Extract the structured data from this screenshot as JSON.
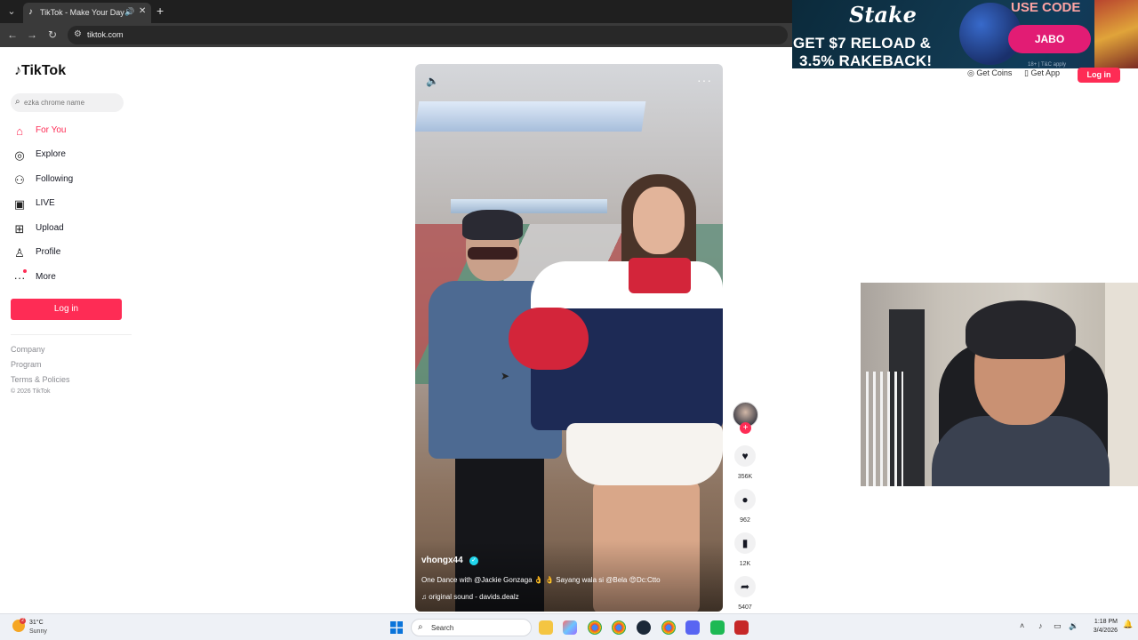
{
  "browser": {
    "tab_title": "TikTok - Make Your Day",
    "tab_close": "✕",
    "new_tab": "+",
    "url": "tiktok.com"
  },
  "ad": {
    "brand": "Stake",
    "line1": "GET $7 RELOAD &",
    "line2": "3.5% RAKEBACK!",
    "code_label": "USE CODE",
    "code": "JABO",
    "fine_print": "18+ | T&C apply"
  },
  "header": {
    "get_coins": "Get Coins",
    "get_app": "Get App",
    "login": "Log in"
  },
  "sidebar": {
    "logo": "TikTok",
    "search_placeholder": "ezka chrome name",
    "items": [
      {
        "label": "For You",
        "icon": "home-icon"
      },
      {
        "label": "Explore",
        "icon": "compass-icon"
      },
      {
        "label": "Following",
        "icon": "following-icon"
      },
      {
        "label": "LIVE",
        "icon": "live-icon"
      },
      {
        "label": "Upload",
        "icon": "upload-icon"
      },
      {
        "label": "Profile",
        "icon": "profile-icon"
      },
      {
        "label": "More",
        "icon": "more-icon"
      }
    ],
    "login": "Log in",
    "footer": [
      "Company",
      "Program",
      "Terms & Policies"
    ],
    "copyright": "© 2026 TikTok"
  },
  "video": {
    "username": "vhongx44",
    "description": "One Dance with @Jackie Gonzaga 👌 👌 Sayang wala si @Bela 😍Dc:Ctto",
    "sound": "original sound - davids.dealz"
  },
  "actions": {
    "likes": "356K",
    "comments": "962",
    "saves": "12K",
    "shares": "5407"
  },
  "taskbar": {
    "temp": "31°C",
    "weather": "Sunny",
    "weather_badge": "2",
    "search": "Search",
    "time": "1:18 PM",
    "date": "3/4/2026"
  },
  "colors": {
    "tiktok_accent": "#fe2c55",
    "ad_pill": "#e21c74",
    "verified": "#20d5ec"
  }
}
